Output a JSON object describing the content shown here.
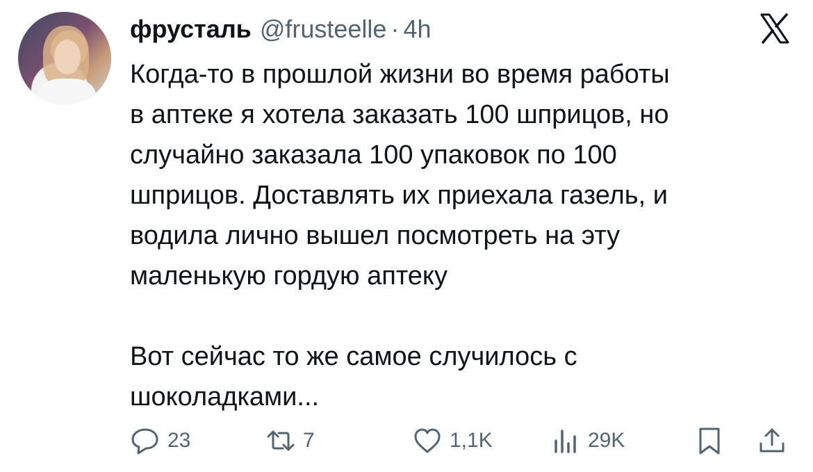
{
  "tweet": {
    "display_name": "фрусталь",
    "handle": "@frusteelle",
    "separator": "·",
    "time": "4h",
    "text": "Когда-то в прошлой жизни во время работы\nв аптеке я хотела заказать 100 шприцов, но\nслучайно заказала 100 упаковок по 100\nшприцов. Доставлять их приехала газель, и\nводила лично вышел посмотреть на эту\nмаленькую гордую аптеку\n\nВот сейчас то же самое случилось с\nшоколадками..."
  },
  "actions": {
    "replies": "23",
    "reposts": "7",
    "likes": "1,1K",
    "views": "29K"
  },
  "icons": {
    "brand": "x-logo-icon",
    "reply": "reply-icon",
    "repost": "repost-icon",
    "like": "heart-icon",
    "views": "views-icon",
    "bookmark": "bookmark-icon",
    "share": "share-icon"
  },
  "colors": {
    "text": "#0f1419",
    "muted": "#536471",
    "background": "#ffffff"
  }
}
